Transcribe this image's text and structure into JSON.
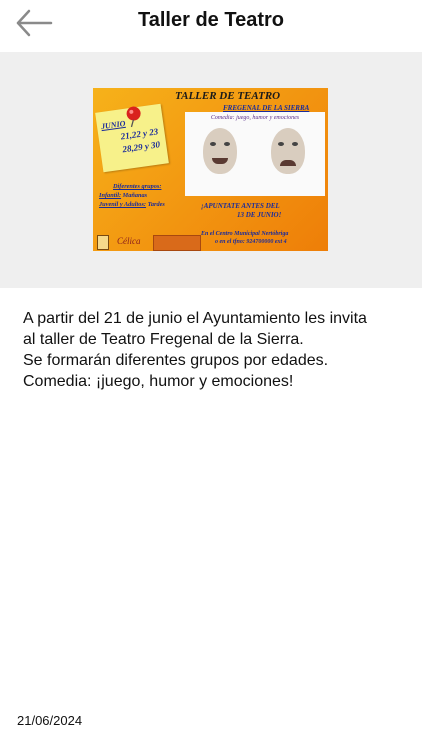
{
  "header": {
    "title": "Taller de Teatro"
  },
  "poster": {
    "title": "TALLER DE TEATRO",
    "subtitle": "FREGENAL DE LA SIERRA",
    "month": "JUNIO",
    "dates_line1": "21,22 y 23",
    "dates_line2": "28,29 y 30",
    "faces_label": "Comedia: juego, humor y emociones",
    "groups_heading": "Diferentes grupos:",
    "group_1_label": "Infantil:",
    "group_1_value": "Mañanas",
    "group_2_label": "Juvenil y Adultos:",
    "group_2_value": "Tardes",
    "signup_line1": "¡APUNTATE ANTES DEL",
    "signup_line2": "13 DE JUNIO!",
    "venue_line1": "En el Centro Municipal Nertóbriga",
    "venue_line2": "o en el tfno: 924700000 ext 4",
    "logo_text": "Célica"
  },
  "content": {
    "lines": [
      "A partir del 21 de junio el Ayuntamiento les invita",
      "al taller de Teatro Fregenal de la Sierra.",
      "Se formarán diferentes grupos por edades.",
      "Comedia: ¡juego, humor y emociones!"
    ]
  },
  "footer": {
    "date": "21/06/2024"
  },
  "icons": {
    "back": "arrow-left-icon",
    "pin": "pushpin-icon"
  },
  "colors": {
    "header_bg": "#ffffff",
    "image_bg": "#efefef",
    "back_arrow": "#8a8a8a",
    "poster_text": "#1b2c9b"
  }
}
